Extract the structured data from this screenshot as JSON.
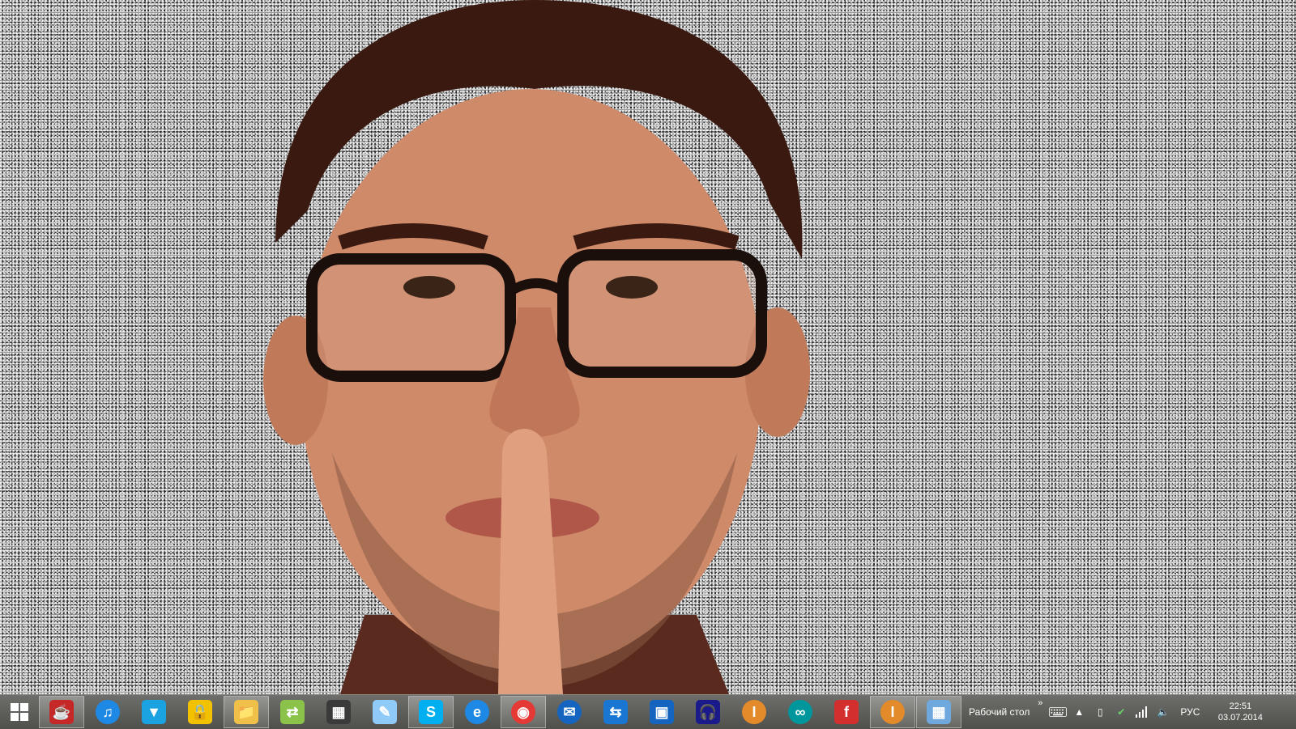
{
  "taskbar": {
    "start_icon": "windows-logo-icon",
    "pinned": [
      {
        "name": "java-icon",
        "color": "#c62828",
        "glyph": "☕",
        "active": true
      },
      {
        "name": "itunes-icon",
        "color": "#1e88e5",
        "glyph": "♫",
        "active": false
      },
      {
        "name": "arrow-app-icon",
        "color": "#1aa3e0",
        "glyph": "▼",
        "active": false
      },
      {
        "name": "lock-app-icon",
        "color": "#f2c200",
        "glyph": "🔒",
        "active": false
      },
      {
        "name": "file-explorer-icon",
        "color": "#f0c048",
        "glyph": "📁",
        "active": true
      },
      {
        "name": "sync-app-icon",
        "color": "#8bc34a",
        "glyph": "⇄",
        "active": false
      },
      {
        "name": "task-manager-icon",
        "color": "#3a3a3a",
        "glyph": "▦",
        "active": false
      },
      {
        "name": "notepad-icon",
        "color": "#90caf9",
        "glyph": "✎",
        "active": false
      },
      {
        "name": "skype-icon",
        "color": "#00aff0",
        "glyph": "S",
        "active": true
      },
      {
        "name": "internet-explorer-icon",
        "color": "#1e88e5",
        "glyph": "e",
        "active": false
      },
      {
        "name": "chrome-icon",
        "color": "#e53935",
        "glyph": "◉",
        "active": true
      },
      {
        "name": "thunderbird-icon",
        "color": "#1565c0",
        "glyph": "✉",
        "active": false
      },
      {
        "name": "network-app-icon",
        "color": "#1976d2",
        "glyph": "⇆",
        "active": false
      },
      {
        "name": "remote-desktop-icon",
        "color": "#1565c0",
        "glyph": "▣",
        "active": false
      },
      {
        "name": "audio-headphones-icon",
        "color": "#1a1a8a",
        "glyph": "🎧",
        "active": false
      },
      {
        "name": "app-i-orange-icon",
        "color": "#e38a2a",
        "glyph": "I",
        "active": false
      },
      {
        "name": "arduino-icon",
        "color": "#00979c",
        "glyph": "∞",
        "active": false
      },
      {
        "name": "app-f-red-icon",
        "color": "#d32f2f",
        "glyph": "f",
        "active": false
      },
      {
        "name": "app-i-orange-2-icon",
        "color": "#e38a2a",
        "glyph": "I",
        "active": true
      },
      {
        "name": "calculator-icon",
        "color": "#6fa8dc",
        "glyph": "▦",
        "active": true
      }
    ],
    "toolbar_label": "Рабочий стол",
    "toolbar_chevron": "»",
    "tray_icons": [
      "keyboard-icon",
      "show-hidden-icons-icon",
      "power-icon",
      "security-check-icon",
      "network-signal-icon",
      "volume-icon"
    ],
    "language": "РУС",
    "time": "22:51",
    "date": "03.07.2014"
  }
}
